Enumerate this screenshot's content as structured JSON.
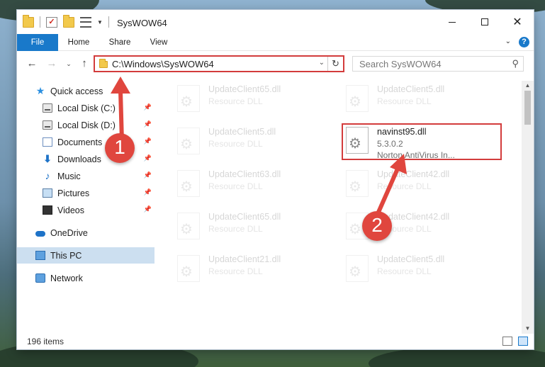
{
  "window": {
    "title": "SysWOW64"
  },
  "ribbon": {
    "tabs": [
      "File",
      "Home",
      "Share",
      "View"
    ],
    "help": "?"
  },
  "address": {
    "path": "C:\\Windows\\SysWOW64"
  },
  "search": {
    "placeholder": "Search SysWOW64"
  },
  "sidebar": {
    "items": [
      {
        "label": "Quick access",
        "icon": "star-icon"
      },
      {
        "label": "Local Disk (C:)",
        "icon": "disk-icon"
      },
      {
        "label": "Local Disk (D:)",
        "icon": "disk-icon"
      },
      {
        "label": "Documents",
        "icon": "documents-icon"
      },
      {
        "label": "Downloads",
        "icon": "download-icon"
      },
      {
        "label": "Music",
        "icon": "music-icon"
      },
      {
        "label": "Pictures",
        "icon": "pictures-icon"
      },
      {
        "label": "Videos",
        "icon": "videos-icon"
      },
      {
        "label": "OneDrive",
        "icon": "cloud-icon"
      },
      {
        "label": "This PC",
        "icon": "computer-icon"
      },
      {
        "label": "Network",
        "icon": "network-icon"
      }
    ]
  },
  "files": [
    {
      "name": "UpdateClient65.dll",
      "line1": "Resource DLL",
      "line2": ""
    },
    {
      "name": "UpdateClient5.dll",
      "line1": "Resource DLL",
      "line2": ""
    },
    {
      "name": "UpdateClient5.dll",
      "line1": "Resource DLL",
      "line2": ""
    },
    {
      "name": "navinst95.dll",
      "line1": "5.3.0.2",
      "line2": "Norton AntiVirus In..."
    },
    {
      "name": "UpdateClient63.dll",
      "line1": "Resource DLL",
      "line2": ""
    },
    {
      "name": "UpdateClient42.dll",
      "line1": "Resource DLL",
      "line2": ""
    },
    {
      "name": "UpdateClient65.dll",
      "line1": "Resource DLL",
      "line2": ""
    },
    {
      "name": "UpdateClient42.dll",
      "line1": "Resource DLL",
      "line2": ""
    },
    {
      "name": "UpdateClient21.dll",
      "line1": "Resource DLL",
      "line2": ""
    },
    {
      "name": "UpdateClient5.dll",
      "line1": "Resource DLL",
      "line2": ""
    }
  ],
  "status": {
    "count": "196 items"
  },
  "annotations": {
    "badge1": "1",
    "badge2": "2",
    "color": "#e0463e"
  }
}
